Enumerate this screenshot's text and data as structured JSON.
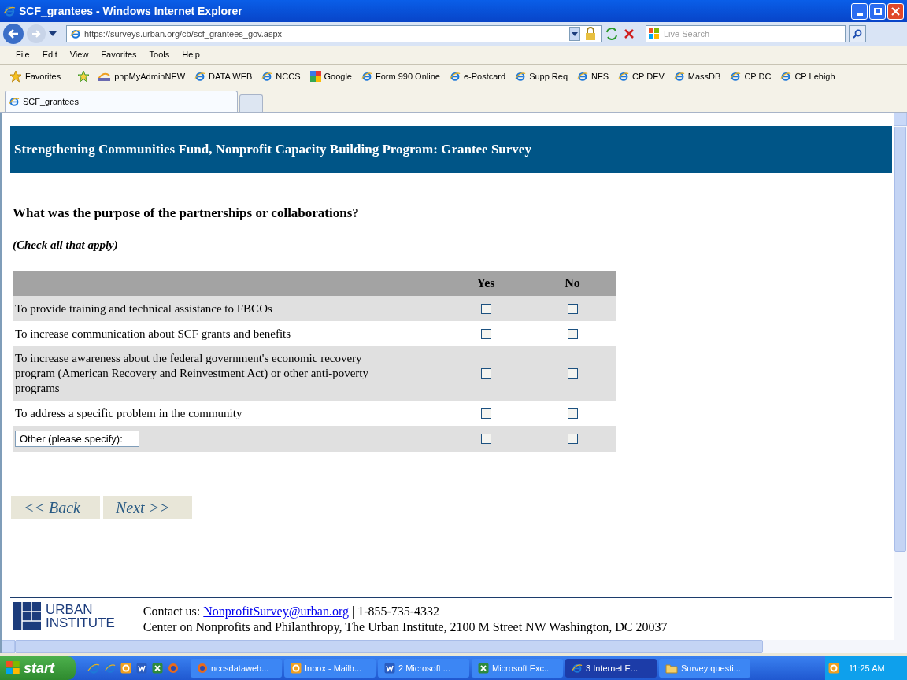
{
  "window": {
    "title": "SCF_grantees - Windows Internet Explorer"
  },
  "address_bar": {
    "url": "https://surveys.urban.org/cb/scf_grantees_gov.aspx"
  },
  "search": {
    "placeholder": "Live Search"
  },
  "menu": [
    "File",
    "Edit",
    "View",
    "Favorites",
    "Tools",
    "Help"
  ],
  "favorites_bar": {
    "label": "Favorites",
    "links": [
      {
        "label": "phpMyAdminNEW",
        "kind": "pma"
      },
      {
        "label": "DATA WEB",
        "kind": "ie"
      },
      {
        "label": "NCCS",
        "kind": "ie"
      },
      {
        "label": "Google",
        "kind": "google"
      },
      {
        "label": "Form 990 Online",
        "kind": "ie"
      },
      {
        "label": "e-Postcard",
        "kind": "ie"
      },
      {
        "label": "Supp Req",
        "kind": "ie"
      },
      {
        "label": "NFS",
        "kind": "ie"
      },
      {
        "label": "CP DEV",
        "kind": "ie"
      },
      {
        "label": "MassDB",
        "kind": "ie"
      },
      {
        "label": "CP DC",
        "kind": "ie"
      },
      {
        "label": "CP Lehigh",
        "kind": "ie"
      }
    ]
  },
  "tabs": [
    {
      "label": "SCF_grantees",
      "selected": true
    }
  ],
  "page": {
    "banner": "Strengthening Communities Fund, Nonprofit Capacity Building Program: Grantee Survey",
    "question": "What was the purpose of the partnerships or collaborations?",
    "instruction": "(Check all that apply)",
    "columns": [
      "Yes",
      "No"
    ],
    "rows": [
      {
        "kind": "text",
        "label": "To provide training and technical assistance to FBCOs",
        "yes": false,
        "no": false
      },
      {
        "kind": "text",
        "label": "To increase communication about SCF grants and benefits",
        "yes": false,
        "no": false
      },
      {
        "kind": "text",
        "label": "To increase awareness about the federal government's economic recovery program (American Recovery and Reinvestment Act) or other anti-poverty programs",
        "yes": false,
        "no": false
      },
      {
        "kind": "text",
        "label": "To address a specific problem in the community",
        "yes": false,
        "no": false
      },
      {
        "kind": "input",
        "value": "Other (please specify):",
        "yes": false,
        "no": false
      }
    ],
    "buttons": [
      "<< Back",
      "Next >>"
    ],
    "footer": {
      "logo": [
        "URBAN",
        "INSTITUTE"
      ],
      "contact_label": "Contact us:",
      "email": "NonprofitSurvey@urban.org",
      "phone": "| 1-855-735-4332",
      "address": "Center on Nonprofits and Philanthropy, The Urban Institute, 2100 M Street NW Washington, DC 20037"
    }
  },
  "taskbar": {
    "start": "start",
    "items": [
      {
        "label": "nccsdataweb...",
        "kind": "firefox",
        "selected": false
      },
      {
        "label": "Inbox - Mailb...",
        "kind": "outlook",
        "selected": false
      },
      {
        "label": "2 Microsoft ...",
        "kind": "word",
        "selected": false
      },
      {
        "label": "Microsoft Exc...",
        "kind": "excel",
        "selected": false
      },
      {
        "label": "3 Internet E...",
        "kind": "ie",
        "selected": true
      },
      {
        "label": "Survey questi...",
        "kind": "folder",
        "selected": false
      }
    ],
    "clock": "11:25 AM"
  }
}
